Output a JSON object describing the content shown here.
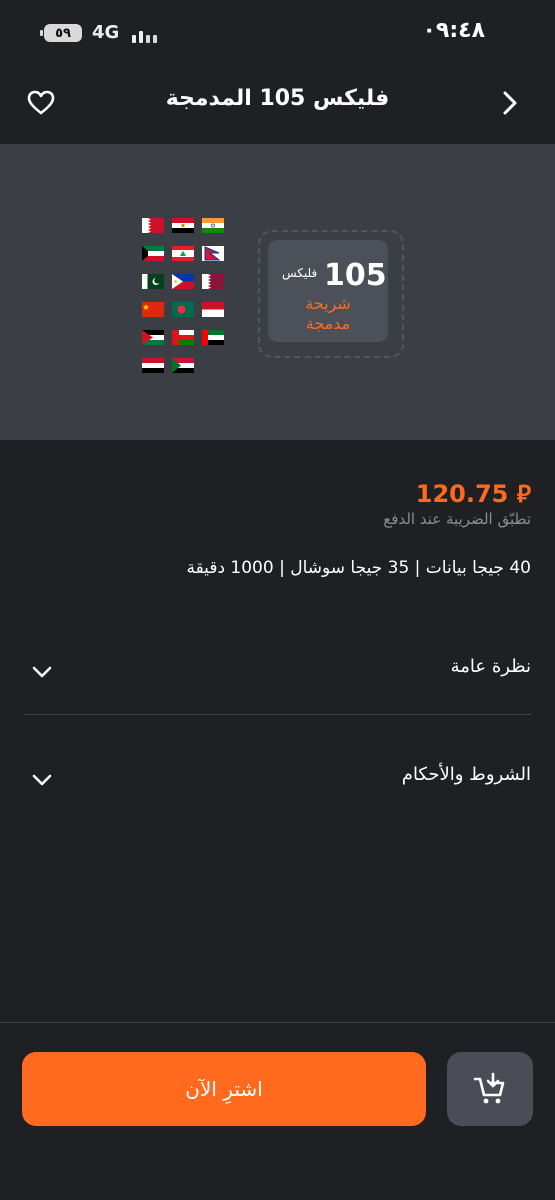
{
  "status_bar": {
    "time": "٠٩:٤٨",
    "battery": "٥٩",
    "network": "4G"
  },
  "nav": {
    "title": "فليكس 105 المدمجة",
    "back_icon": "chevron-right-icon",
    "favorite_icon": "heart-icon"
  },
  "hero": {
    "card_number": "105",
    "card_brand": "فليكس",
    "card_label_line1": "شريحة",
    "card_label_line2": "مدمجة",
    "flags": [
      "bahrain",
      "egypt",
      "india",
      "kuwait",
      "lebanon",
      "nepal",
      "pakistan",
      "philippines",
      "qatar",
      "china",
      "bangladesh",
      "indonesia",
      "jordan",
      "oman",
      "uae",
      "yemen",
      "sudan"
    ]
  },
  "product": {
    "price": "120.75 ⃁",
    "tax_note": "تطبّق الضريبة عند الدفع",
    "bundle": "40 جيجا بيانات | 35 جيجا سوشال | 1000 دقيقة"
  },
  "accordions": [
    {
      "title": "نظرة عامة"
    },
    {
      "title": "الشروط والأحكام"
    }
  ],
  "actions": {
    "buy_label": "اشترِ الآن",
    "cart_icon": "add-to-cart-icon"
  },
  "colors": {
    "background": "#1f2023",
    "hero": "#3b3e45",
    "accent": "#ff6a1f",
    "muted_text": "#8b8d92"
  }
}
